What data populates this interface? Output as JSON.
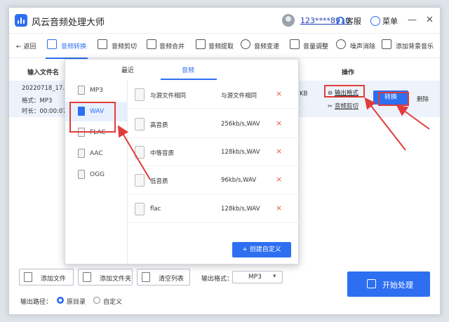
{
  "app": {
    "title": "风云音频处理大师",
    "user_id": "123****8910",
    "service": "客服",
    "menu": "菜单"
  },
  "toolbar": {
    "back": "返回",
    "items": [
      "音频转换",
      "音频剪切",
      "音频合并",
      "音频提取",
      "音频变速",
      "音量调整",
      "噪声消除",
      "添加背景音乐"
    ]
  },
  "table": {
    "col_input": "输入文件名",
    "col_action": "操作",
    "file": {
      "name": "20220718_17...",
      "format": "格式：MP3",
      "duration": "时长：00:00:07.1",
      "size": "KB"
    },
    "output_format_link": "输出格式",
    "cut_link": "音频剪切",
    "convert_btn": "转换",
    "delete": "删除"
  },
  "popup": {
    "tabs": [
      "最近",
      "音频"
    ],
    "formats": [
      "MP3",
      "WAV",
      "FLAC",
      "AAC",
      "OGG"
    ],
    "selected_format": "WAV",
    "qualities": [
      {
        "name": "与源文件相同",
        "value": "与源文件相同"
      },
      {
        "name": "高音质",
        "value": "256kb/s,WAV"
      },
      {
        "name": "中等音质",
        "value": "128kb/s,WAV"
      },
      {
        "name": "低音质",
        "value": "96kb/s,WAV"
      },
      {
        "name": "flac",
        "value": "128kb/s,WAV"
      }
    ],
    "delete_icon": "×",
    "create_custom": "+ 创建自定义"
  },
  "bottom": {
    "add_file": "添加文件",
    "add_folder": "添加文件夹",
    "clear_list": "清空列表",
    "output_format_label": "输出格式：",
    "output_format_value": "MP3",
    "output_path_label": "输出路径：",
    "path_original": "原目录",
    "path_custom": "自定义",
    "start": "开始处理"
  },
  "colors": {
    "accent": "#2d6ff0",
    "highlight": "#e23b3b"
  }
}
